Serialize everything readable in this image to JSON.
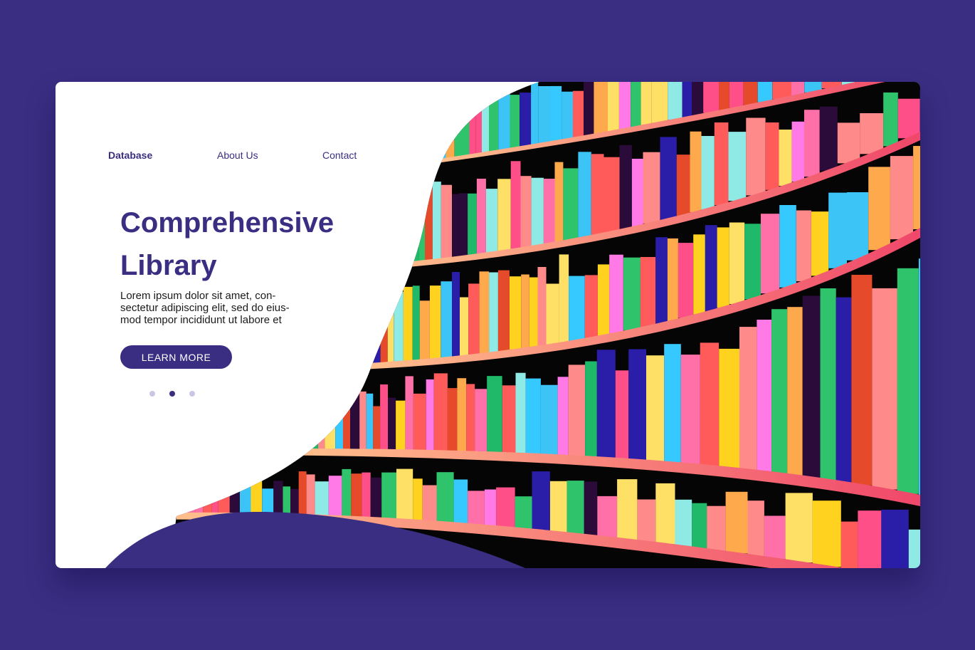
{
  "nav": {
    "items": [
      {
        "label": "Database",
        "active": true
      },
      {
        "label": "About Us",
        "active": false
      },
      {
        "label": "Contact",
        "active": false
      }
    ]
  },
  "hero": {
    "title_line1": "Comprehensive",
    "title_line2": "Library",
    "body": "Lorem ipsum dolor sit amet, con-sectetur adipiscing elit, sed do eius-mod tempor incididunt ut labore et",
    "cta_label": "LEARN MORE"
  },
  "carousel": {
    "slides": 3,
    "active_index": 1
  },
  "colors": {
    "brand": "#3a2e83",
    "background": "#3a2e83",
    "card": "#ffffff",
    "shelf_back": "#050505",
    "shelf_light": "#ffbf8c",
    "shelf_dark": "#f0476a",
    "books": [
      "#ff5b5b",
      "#ffd21f",
      "#2fc46c",
      "#3bc4f5",
      "#ff7ae6",
      "#2a1ea8",
      "#ff8a8a",
      "#ffa94d",
      "#8fe9e5",
      "#e54b2a",
      "#2b0b3a",
      "#ff6fa8",
      "#36c9ff",
      "#ffe066",
      "#20b96a",
      "#ff4f88"
    ]
  }
}
